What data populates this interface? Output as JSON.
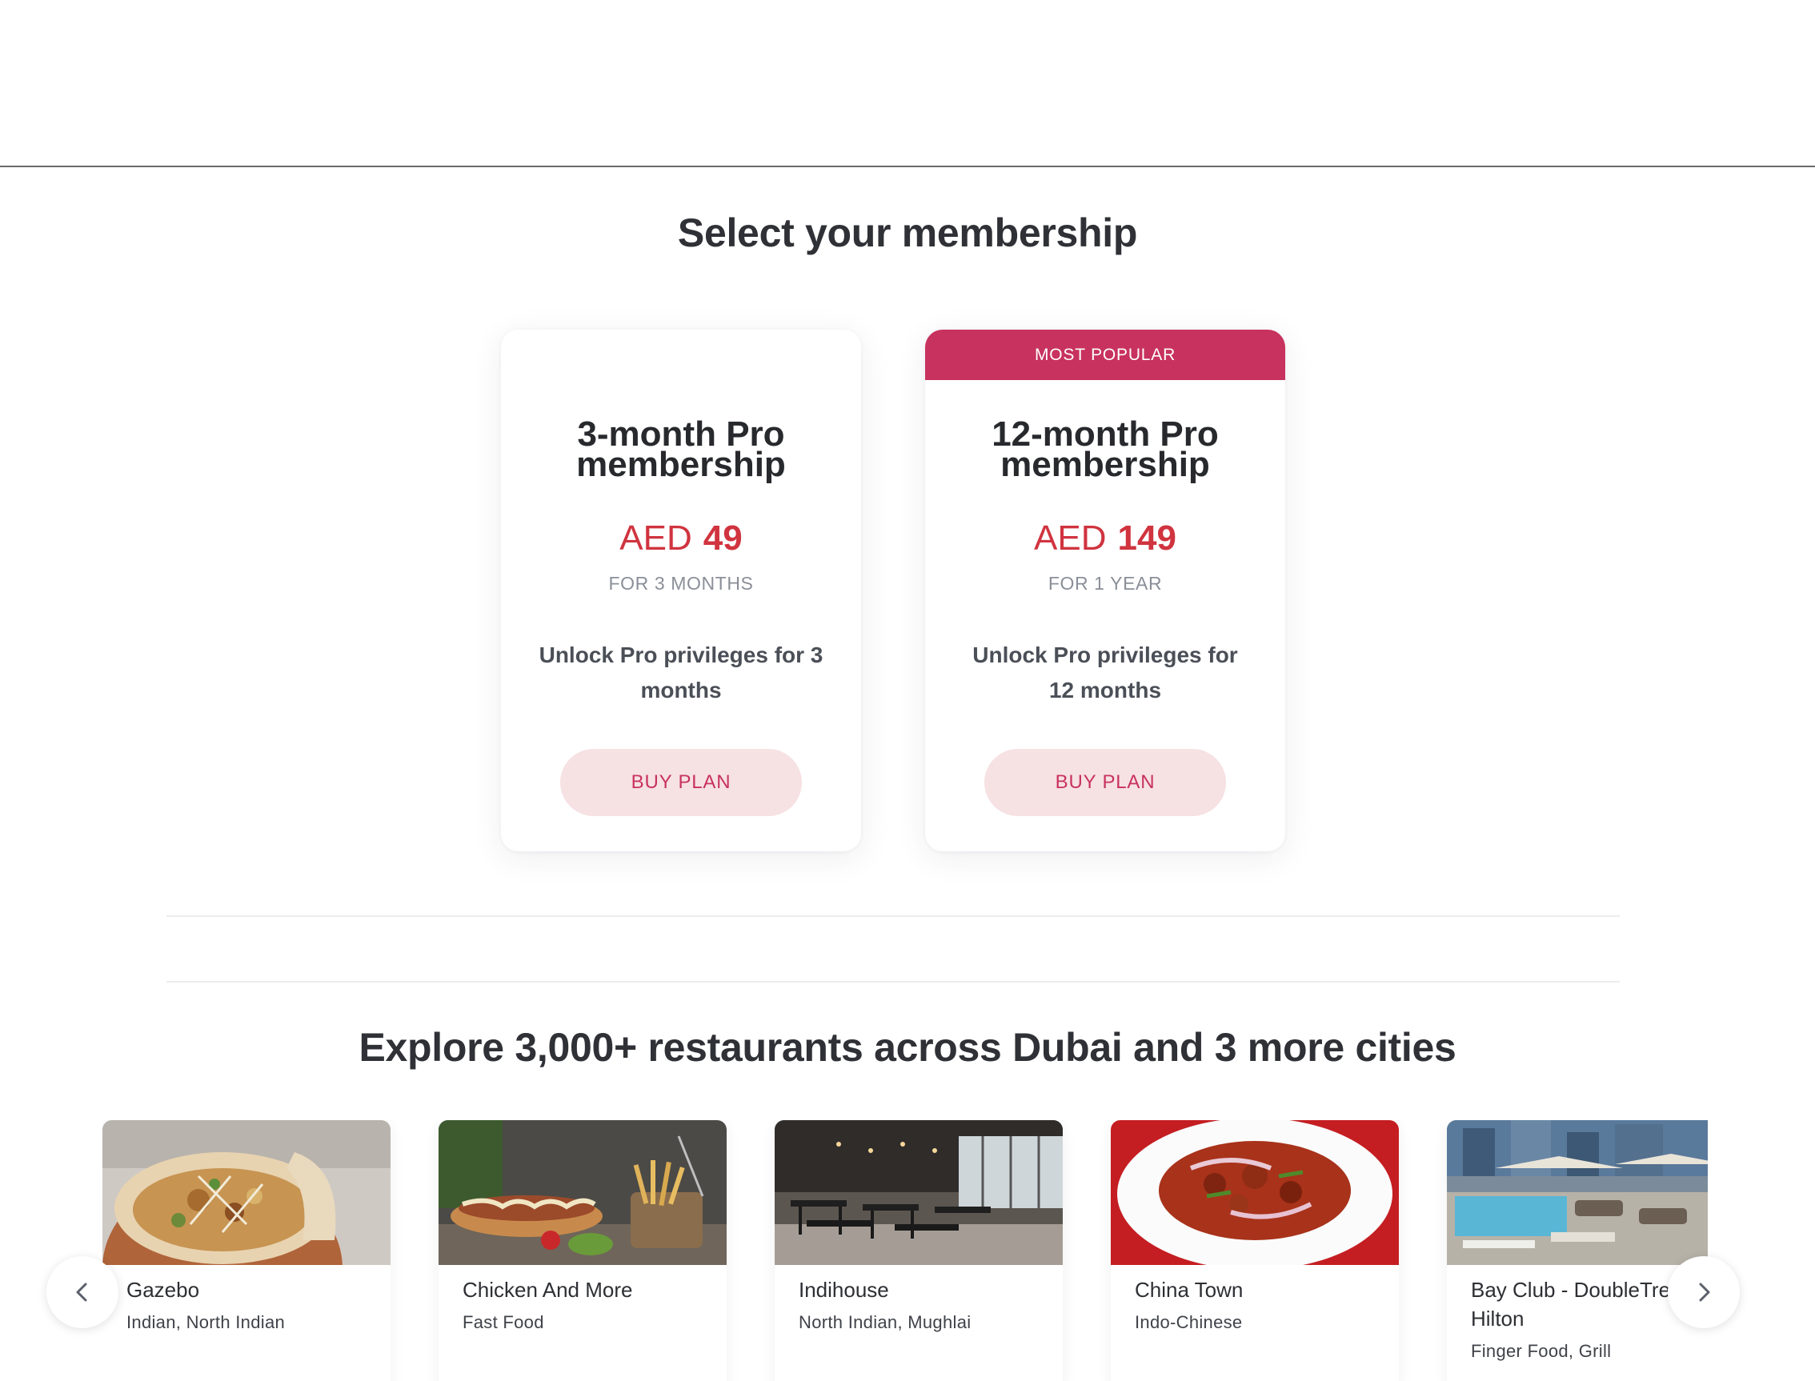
{
  "membership": {
    "title": "Select your membership",
    "plans": [
      {
        "name": "3-month Pro membership",
        "currency": "AED",
        "amount": "49",
        "period": "FOR 3 MONTHS",
        "description": "Unlock Pro privileges for 3 months",
        "button": "BUY PLAN",
        "badge": ""
      },
      {
        "name": "12-month Pro membership",
        "currency": "AED",
        "amount": "149",
        "period": "FOR 1 YEAR",
        "description": "Unlock Pro privileges for 12 months",
        "button": "BUY PLAN",
        "badge": "MOST POPULAR"
      }
    ]
  },
  "explore": {
    "title": "Explore 3,000+ restaurants across Dubai and 3 more cities",
    "restaurants": [
      {
        "name": "Gazebo",
        "cuisine": "Indian, North Indian"
      },
      {
        "name": "Chicken And More",
        "cuisine": "Fast Food"
      },
      {
        "name": "Indihouse",
        "cuisine": "North Indian, Mughlai"
      },
      {
        "name": "China Town",
        "cuisine": "Indo-Chinese"
      },
      {
        "name": "Bay Club - DoubleTree by Hilton",
        "cuisine": "Finger Food, Grill"
      }
    ]
  },
  "icons": {
    "prev": "chevron-left-icon",
    "next": "chevron-right-icon"
  },
  "colors": {
    "accent": "#c8325e",
    "price": "#d0343f",
    "button_bg": "#f6e1e3"
  }
}
